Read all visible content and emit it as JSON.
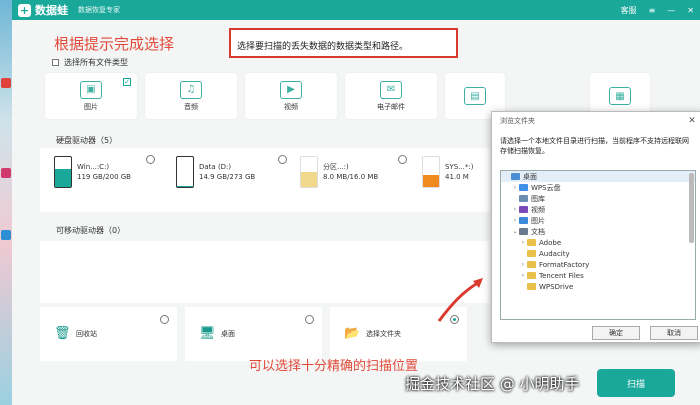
{
  "window": {
    "app_name": "数据蛙",
    "subtitle": "数据恢复专家",
    "support_label": "客服",
    "menu_icon": "hamburger-icon",
    "min_icon": "minimize-icon",
    "close_icon": "close-icon"
  },
  "annotations": {
    "left": "根据提示完成选择",
    "box": "选择要扫描的丢失数据的数据类型和路径。",
    "bottom": "可以选择十分精确的扫描位置",
    "watermark": "掘金技术社区 @ 小明助手"
  },
  "select_all_label": "选择所有文件类型",
  "file_types": [
    {
      "label": "图片",
      "icon": "image-icon",
      "checked": true
    },
    {
      "label": "音频",
      "icon": "music-icon",
      "checked": false
    },
    {
      "label": "视频",
      "icon": "video-icon",
      "checked": false
    },
    {
      "label": "电子邮件",
      "icon": "mail-icon",
      "checked": false
    }
  ],
  "hard_drives": {
    "title": "硬盘驱动器（5）",
    "items": [
      {
        "name": "Win...:C:)",
        "size": "119 GB/200 GB",
        "used": 0.6,
        "color": "#1aa89a"
      },
      {
        "name": "Data (D:)",
        "size": "14.9 GB/273 GB",
        "used": 0.05,
        "color": "#1aa89a"
      },
      {
        "name": "分区...:)",
        "size": "8.0 MB/16.0 MB",
        "used": 0.5,
        "color": "#f0d98a"
      },
      {
        "name": "SYS...*:)",
        "size": "41.0 M",
        "used": 0.4,
        "color": "#f08a1e"
      }
    ]
  },
  "removable": {
    "title": "可移动驱动器（0）"
  },
  "locations": [
    {
      "label": "回收站",
      "icon": "recycle-bin-icon",
      "selected": false
    },
    {
      "label": "桌面",
      "icon": "desktop-icon",
      "selected": false
    },
    {
      "label": "选择文件夹",
      "icon": "folder-icon",
      "selected": true
    }
  ],
  "start_label": "扫描",
  "dialog": {
    "title": "浏览文件夹",
    "message": "请选择一个本地文件目录进行扫描，当前程序不支持远程联网存储扫描恢复。",
    "tree": [
      {
        "label": "桌面",
        "indent": 0,
        "arrow": "",
        "color": "#4a8fd6"
      },
      {
        "label": "WPS云盘",
        "indent": 1,
        "arrow": ">",
        "color": "#3f8ee8"
      },
      {
        "label": "图库",
        "indent": 1,
        "arrow": "",
        "color": "#6a8fb3"
      },
      {
        "label": "视频",
        "indent": 1,
        "arrow": ">",
        "color": "#7b4bb8"
      },
      {
        "label": "图片",
        "indent": 1,
        "arrow": ">",
        "color": "#3c8ad8"
      },
      {
        "label": "文档",
        "indent": 1,
        "arrow": "v",
        "color": "#6c7b8f"
      },
      {
        "label": "Adobe",
        "indent": 2,
        "arrow": ">",
        "color": "#e9c14a"
      },
      {
        "label": "Audacity",
        "indent": 2,
        "arrow": "",
        "color": "#e9c14a"
      },
      {
        "label": "FormatFactory",
        "indent": 2,
        "arrow": ">",
        "color": "#e9c14a"
      },
      {
        "label": "Tencent Files",
        "indent": 2,
        "arrow": ">",
        "color": "#e9c14a"
      },
      {
        "label": "WPSDrive",
        "indent": 2,
        "arrow": "",
        "color": "#e9c14a"
      }
    ],
    "ok_label": "确定",
    "cancel_label": "取消"
  }
}
